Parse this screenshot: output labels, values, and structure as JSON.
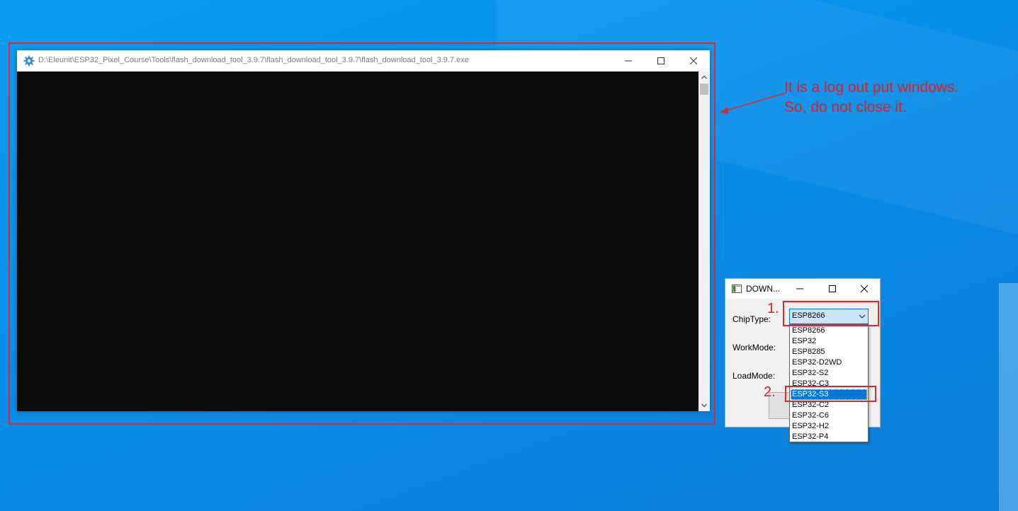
{
  "console_window": {
    "title": "D:\\Eleunit\\ESP32_Pixel_Course\\Tools\\flash_download_tool_3.9.7\\flash_download_tool_3.9.7\\flash_download_tool_3.9.7.exe"
  },
  "download_window": {
    "title": "DOWN...",
    "chip_type_label": "ChipType:",
    "work_mode_label": "WorkMode:",
    "load_mode_label": "LoadMode:",
    "chip_type_value": "ESP8266",
    "options": [
      "ESP8266",
      "ESP32",
      "ESP8285",
      "ESP32-D2WD",
      "ESP32-S2",
      "ESP32-C3",
      "ESP32-S3",
      "ESP32-C2",
      "ESP32-C6",
      "ESP32-H2",
      "ESP32-P4"
    ],
    "selected_option": "ESP32-S3"
  },
  "annotations": {
    "note_line1": "It is a log out put windows.",
    "note_line2": "So, do not close it.",
    "step1": "1.",
    "step2": "2."
  },
  "colors": {
    "annotation_red": "#e3262b",
    "desktop_blue": "#0790ea",
    "console_bg": "#0c0c0c",
    "selection_blue": "#0078d7"
  },
  "icons": {
    "console_app": "gear-icon",
    "dialog_app": "window-icon",
    "minimize": "minimize-icon",
    "maximize": "maximize-icon",
    "close": "close-icon",
    "combo": "chevron-down-icon"
  }
}
